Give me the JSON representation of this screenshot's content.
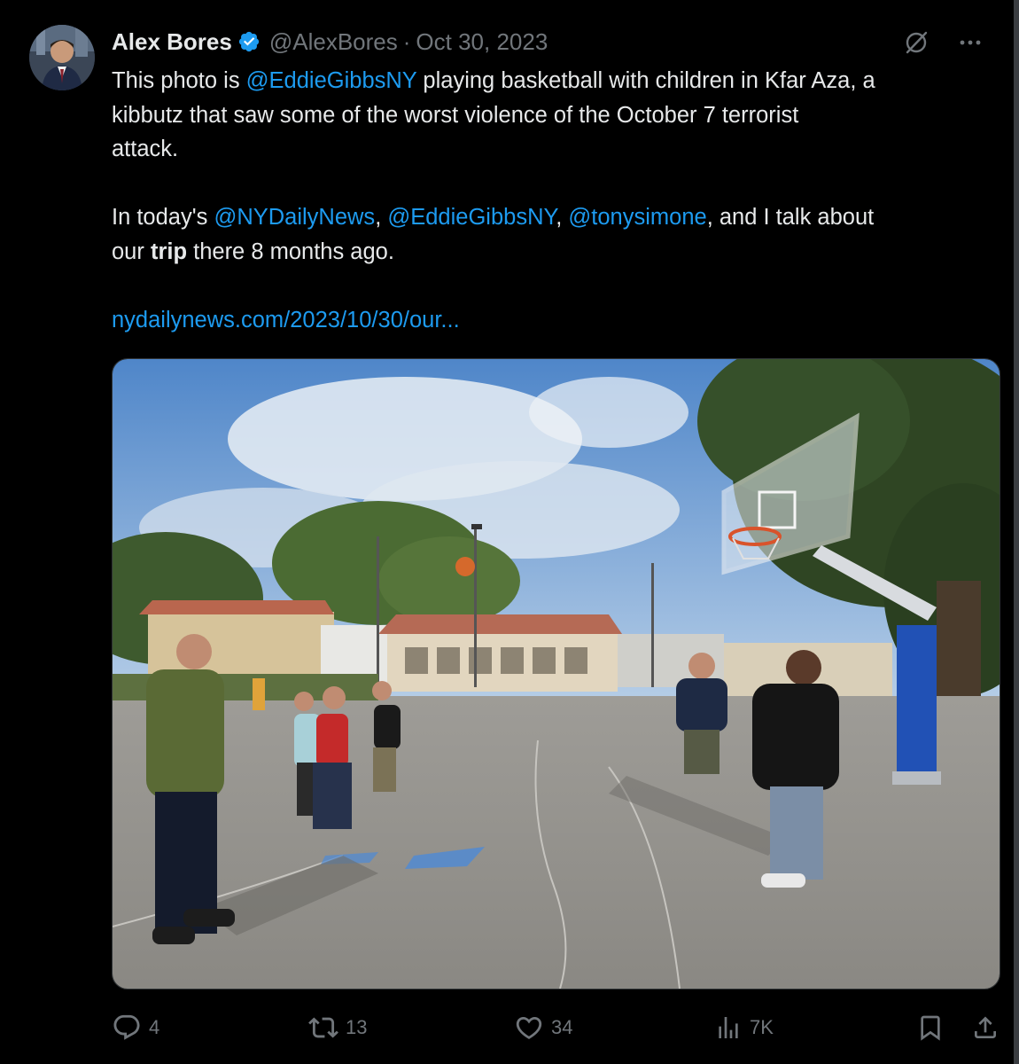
{
  "author": {
    "name": "Alex Bores",
    "handle": "@AlexBores",
    "separator": "·",
    "date": "Oct 30, 2023",
    "verified_icon": "verified-badge-icon"
  },
  "top_icons": [
    "grok-icon",
    "more-icon"
  ],
  "tweet": {
    "p1_part1": "This photo is ",
    "p1_mention": "@EddieGibbsNY",
    "p1_line1_rest": " playing basketball with children in Kfar Aza, a",
    "p1_line2": "kibbutz that saw some of the worst violence of the October 7 terrorist",
    "p1_line3": "attack.",
    "p2_part1": "In today's ",
    "p2_mention1": "@NYDailyNews",
    "p2_comma1": ", ",
    "p2_mention2": "@EddieGibbsNY",
    "p2_comma2": ", ",
    "p2_mention3": "@tonysimone",
    "p2_rest": ", and I talk about",
    "p2_line2_start": "our ",
    "p2_bold": "trip",
    "p2_line2_end": " there 8 months ago.",
    "link": "nydailynews.com/2023/10/30/our..."
  },
  "actions": {
    "replies": "4",
    "reposts": "13",
    "likes": "34",
    "views": "7K"
  },
  "colors": {
    "background": "#000000",
    "text": "#e7e9ea",
    "secondary": "#71767b",
    "accent": "#1d9bf0"
  }
}
